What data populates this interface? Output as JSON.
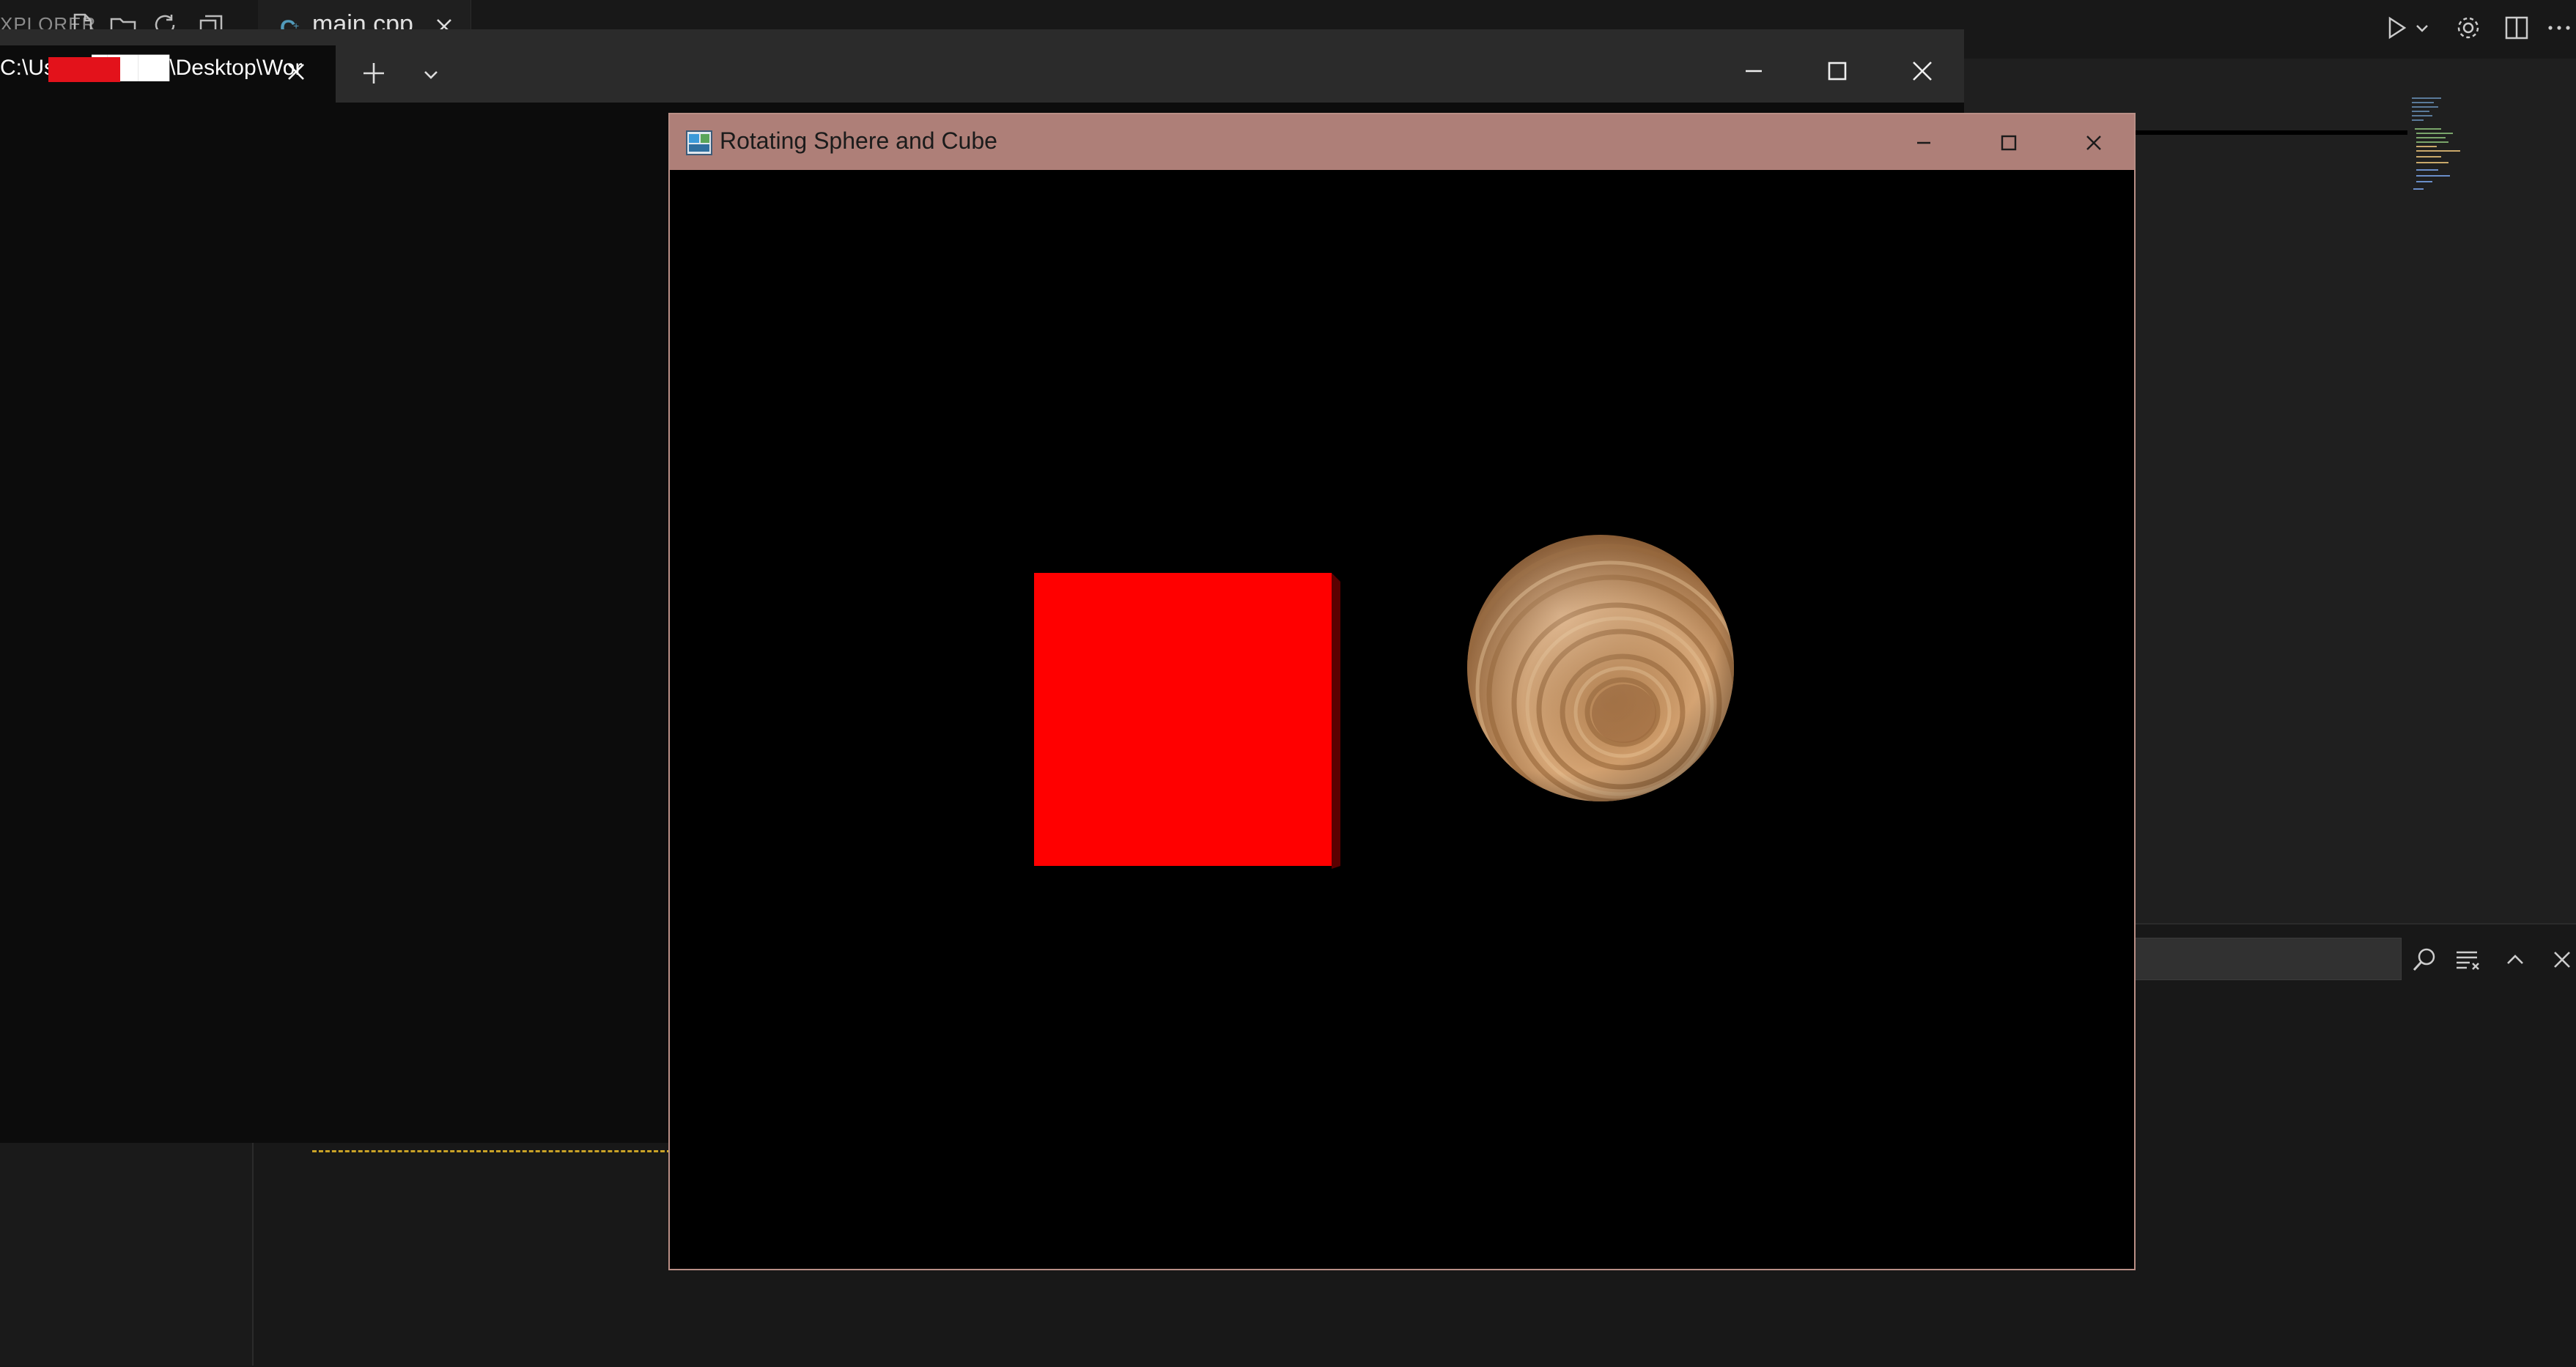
{
  "ide": {
    "explorer_title": "XPLORER",
    "icons": [
      "new-file-icon",
      "new-folder-icon",
      "refresh-icon",
      "collapse-icon",
      "run-icon",
      "chevron-down-icon",
      "gear-icon",
      "split-editor-icon",
      "more-icon",
      "search-icon",
      "clear-icon",
      "chevron-up-icon",
      "close-icon"
    ],
    "editor_tab": {
      "label": "main.cpp",
      "icon": "cpp-file-icon"
    },
    "panel": {
      "accent_color": "#c9a227"
    }
  },
  "terminal": {
    "tab_title": "C:\\Users\\█████\\Desktop\\Wor",
    "new_tab_icon": "plus-icon",
    "dropdown_icon": "chevron-down-icon",
    "controls": [
      "minimize-icon",
      "maximize-icon",
      "close-icon"
    ]
  },
  "gl_window": {
    "title": "Rotating Sphere and Cube",
    "title_bar_color": "#ae7f78",
    "controls": [
      "minimize-icon",
      "maximize-icon",
      "close-icon"
    ],
    "scene": {
      "cube": {
        "color": "#ff0000",
        "shape": "cube"
      },
      "sphere": {
        "color": "#c8955e",
        "texture": "wood",
        "shape": "sphere"
      }
    }
  }
}
